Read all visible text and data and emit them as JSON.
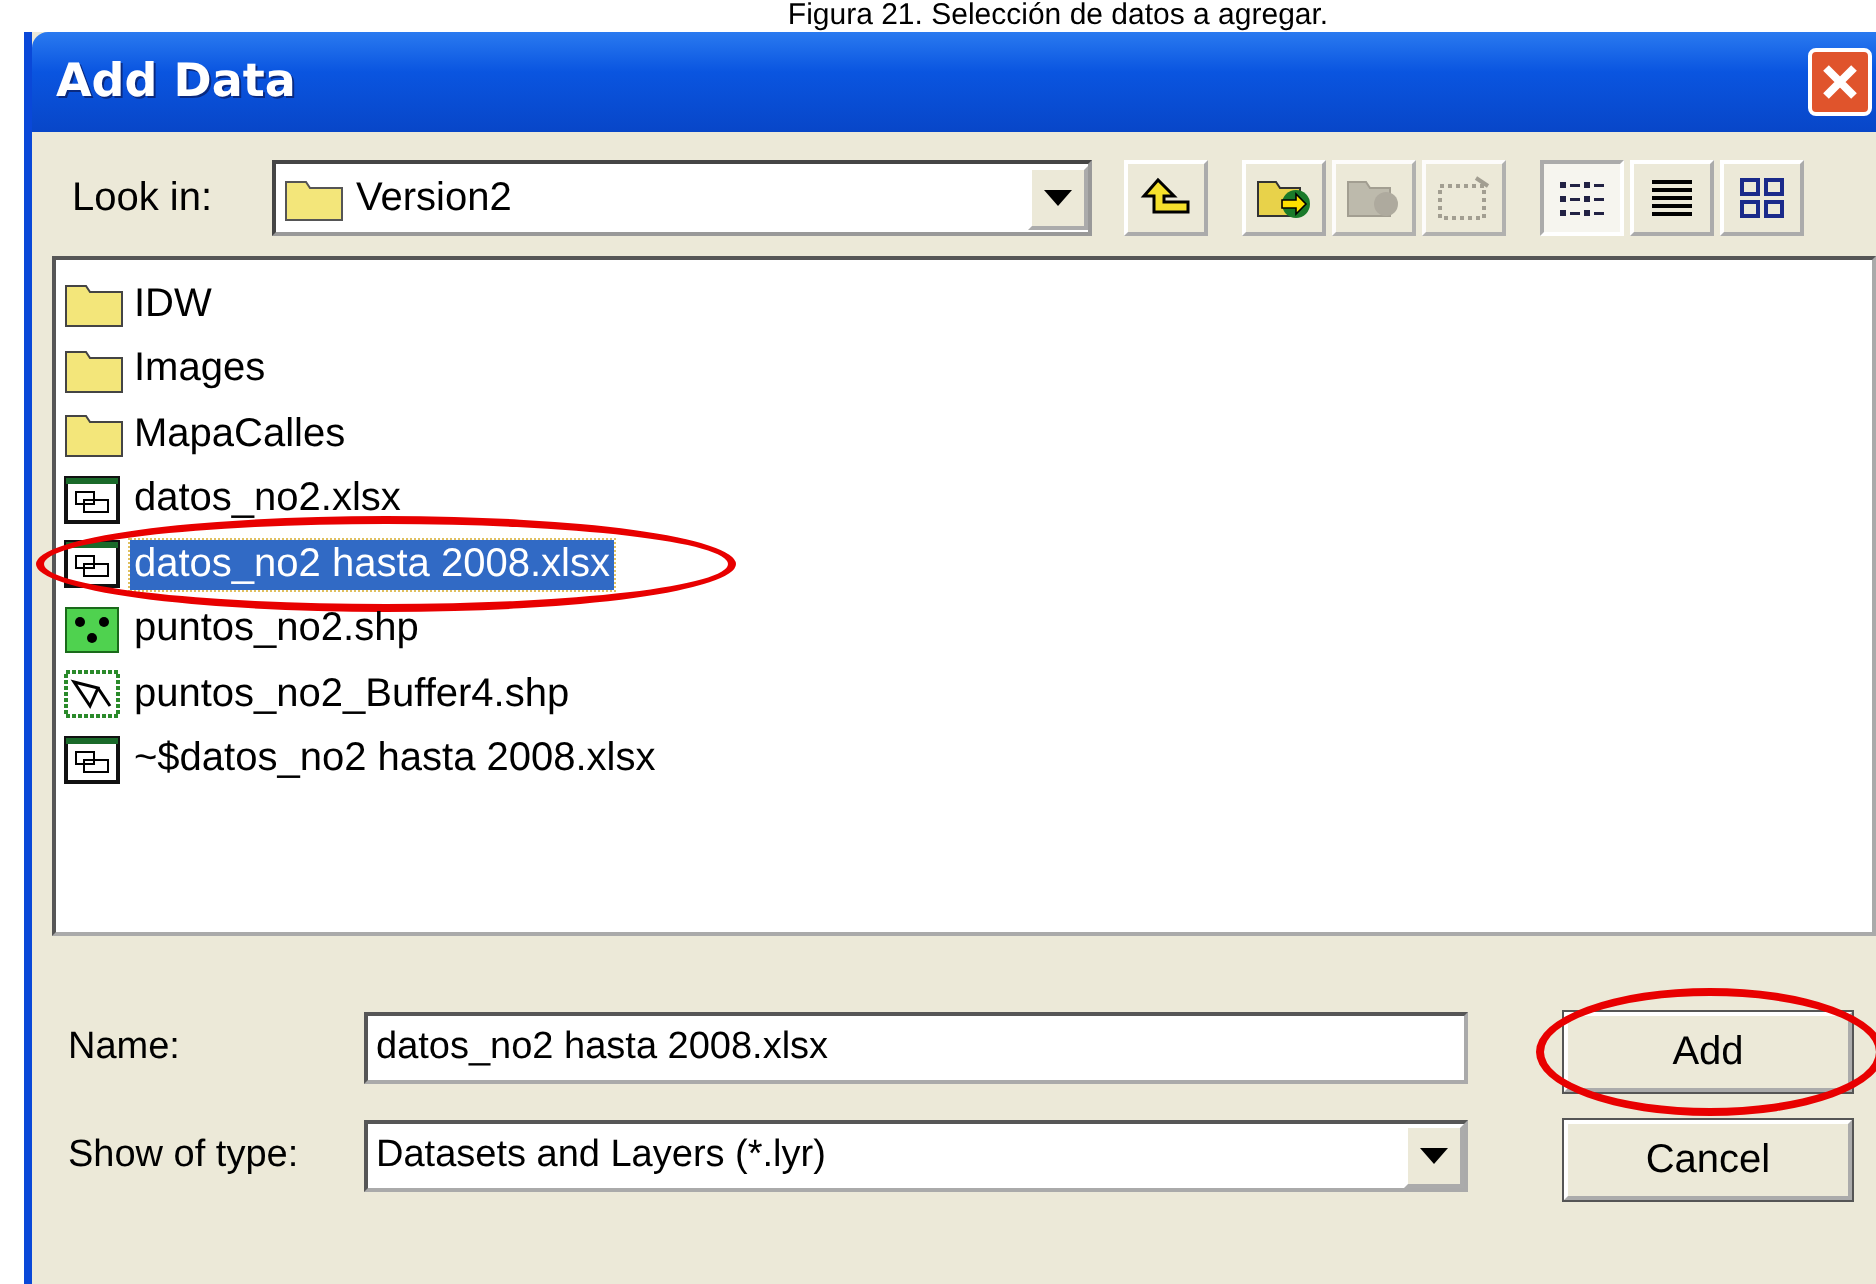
{
  "caption": "Figura 21. Selección de datos a agregar.",
  "window": {
    "title": "Add Data"
  },
  "look_in": {
    "label": "Look in:",
    "value": "Version2"
  },
  "toolbar": [
    {
      "kind": "up",
      "disabled": false,
      "selected": false
    },
    {
      "kind": "connect",
      "disabled": false,
      "selected": false
    },
    {
      "kind": "disconnect",
      "disabled": true,
      "selected": false
    },
    {
      "kind": "options",
      "disabled": true,
      "selected": false
    },
    {
      "kind": "list",
      "disabled": false,
      "selected": true
    },
    {
      "kind": "details",
      "disabled": false,
      "selected": false
    },
    {
      "kind": "thumbnails",
      "disabled": false,
      "selected": false
    }
  ],
  "files": [
    {
      "name": "IDW",
      "kind": "folder",
      "selected": false,
      "circled": false
    },
    {
      "name": "Images",
      "kind": "folder",
      "selected": false,
      "circled": false
    },
    {
      "name": "MapaCalles",
      "kind": "folder",
      "selected": false,
      "circled": false
    },
    {
      "name": "datos_no2.xlsx",
      "kind": "table",
      "selected": false,
      "circled": false
    },
    {
      "name": "datos_no2 hasta 2008.xlsx",
      "kind": "table",
      "selected": true,
      "circled": true
    },
    {
      "name": "puntos_no2.shp",
      "kind": "points",
      "selected": false,
      "circled": false
    },
    {
      "name": "puntos_no2_Buffer4.shp",
      "kind": "polygons",
      "selected": false,
      "circled": false
    },
    {
      "name": "~$datos_no2 hasta 2008.xlsx",
      "kind": "table",
      "selected": false,
      "circled": false
    }
  ],
  "name_field": {
    "label": "Name:",
    "value": "datos_no2 hasta 2008.xlsx"
  },
  "type_field": {
    "label": "Show of type:",
    "value": "Datasets and Layers (*.lyr)"
  },
  "buttons": [
    {
      "label": "Add",
      "circled": true
    },
    {
      "label": "Cancel",
      "circled": false
    }
  ]
}
